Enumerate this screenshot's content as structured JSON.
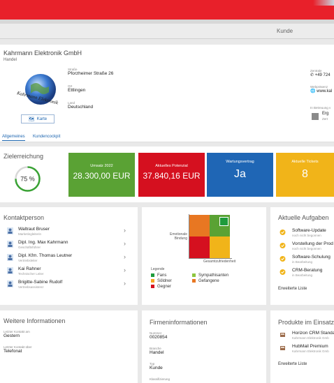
{
  "header": {
    "page_title": "Kunde"
  },
  "account": {
    "name": "Kahrmann Elektronik GmbH",
    "industry": "Handel",
    "logo_text": "Kahrmann Elektronik",
    "street_label": "Straße",
    "street": "Pforzheimer Straße 26",
    "city_label": "Ort",
    "city": "Ettlingen",
    "country_label": "Land",
    "country": "Deutschland",
    "map_button": "Karte",
    "phone_label": "Zentrale",
    "phone": "+49 724",
    "website_label": "Webpräsenz",
    "website": "www.kal",
    "care_label": "In Betreuung v",
    "care_value": "Erg",
    "care_sub": "Zert"
  },
  "tabs": [
    "Allgemeines",
    "Kundencockpit"
  ],
  "kpis": {
    "goal_title": "Zielerreichung",
    "goal_percent": 0.75,
    "goal_label": "75 %",
    "tiles": [
      {
        "label": "Umsatz 2022",
        "value": "28.300,00 EUR",
        "color": "#5aa234"
      },
      {
        "label": "Aktuelles Potenzial",
        "value": "37.840,16 EUR",
        "color": "#d5101f"
      },
      {
        "label": "Wartungsvertrag",
        "value": "Ja",
        "color": "#1f66b5"
      },
      {
        "label": "Aktuelle Tickets",
        "value": "8",
        "color": "#f1b419"
      }
    ]
  },
  "contacts": {
    "title": "Kontaktperson",
    "items": [
      {
        "name": "Waltraut Bruser",
        "role": "Marketingleiterin"
      },
      {
        "name": "Dipl. Ing. Max Kahrmann",
        "role": "Geschäftsführer"
      },
      {
        "name": "Dipl. Kfm. Thomas Leutner",
        "role": "Vertriebsleiter"
      },
      {
        "name": "Kai Rahner",
        "role": "Technischer Leiter"
      },
      {
        "name": "Brigitte-Sabine Rudolf",
        "role": "Vertriebsassistenz"
      }
    ]
  },
  "matrix": {
    "y_label_1": "Emotionale",
    "y_label_2": "Bindung",
    "x_label": "Gesamtzufriedenheit",
    "legend_title": "Legende",
    "legend": [
      {
        "label": "Fans",
        "color": "#1e9b3c"
      },
      {
        "label": "Sympathisanten",
        "color": "#8dc63f"
      },
      {
        "label": "Söldner",
        "color": "#f5a623"
      },
      {
        "label": "Gefangene",
        "color": "#e87722"
      },
      {
        "label": "Gegner",
        "color": "#d5101f"
      }
    ]
  },
  "tasks": {
    "title": "Aktuelle Aufgaben",
    "items": [
      {
        "name": "Software-Update",
        "status": "noch nicht begonnen"
      },
      {
        "name": "Vorstellung der Prod",
        "status": "noch nicht begonnen"
      },
      {
        "name": "Software-Schulung",
        "status": "in Bearbeitung"
      },
      {
        "name": "CRM-Beratung",
        "status": "in Bearbeitung"
      }
    ],
    "more": "Erweiterte Liste"
  },
  "further": {
    "title": "Weitere Informationen",
    "last_contact_label": "Letzter Kontakt am",
    "last_contact": "Gestern",
    "last_contact_via_label": "Letzter Kontakt über",
    "last_contact_via": "Telefonat"
  },
  "company": {
    "title": "Firmeninformationen",
    "number_label": "Nummer",
    "number": "0020854",
    "branch_label": "Branche",
    "branch": "Handel",
    "type_label": "Typ",
    "type": "Kunde",
    "class_label": "Klassifizierung"
  },
  "products": {
    "title": "Produkte im Einsatz",
    "items": [
      {
        "name": "Horizon CRM Standa",
        "vendor": "Kahrmann Elektronik Gmb"
      },
      {
        "name": "HubMail Premium",
        "vendor": "Kahrmann Elektronik Gmb"
      }
    ],
    "more": "Erweiterte Liste"
  }
}
